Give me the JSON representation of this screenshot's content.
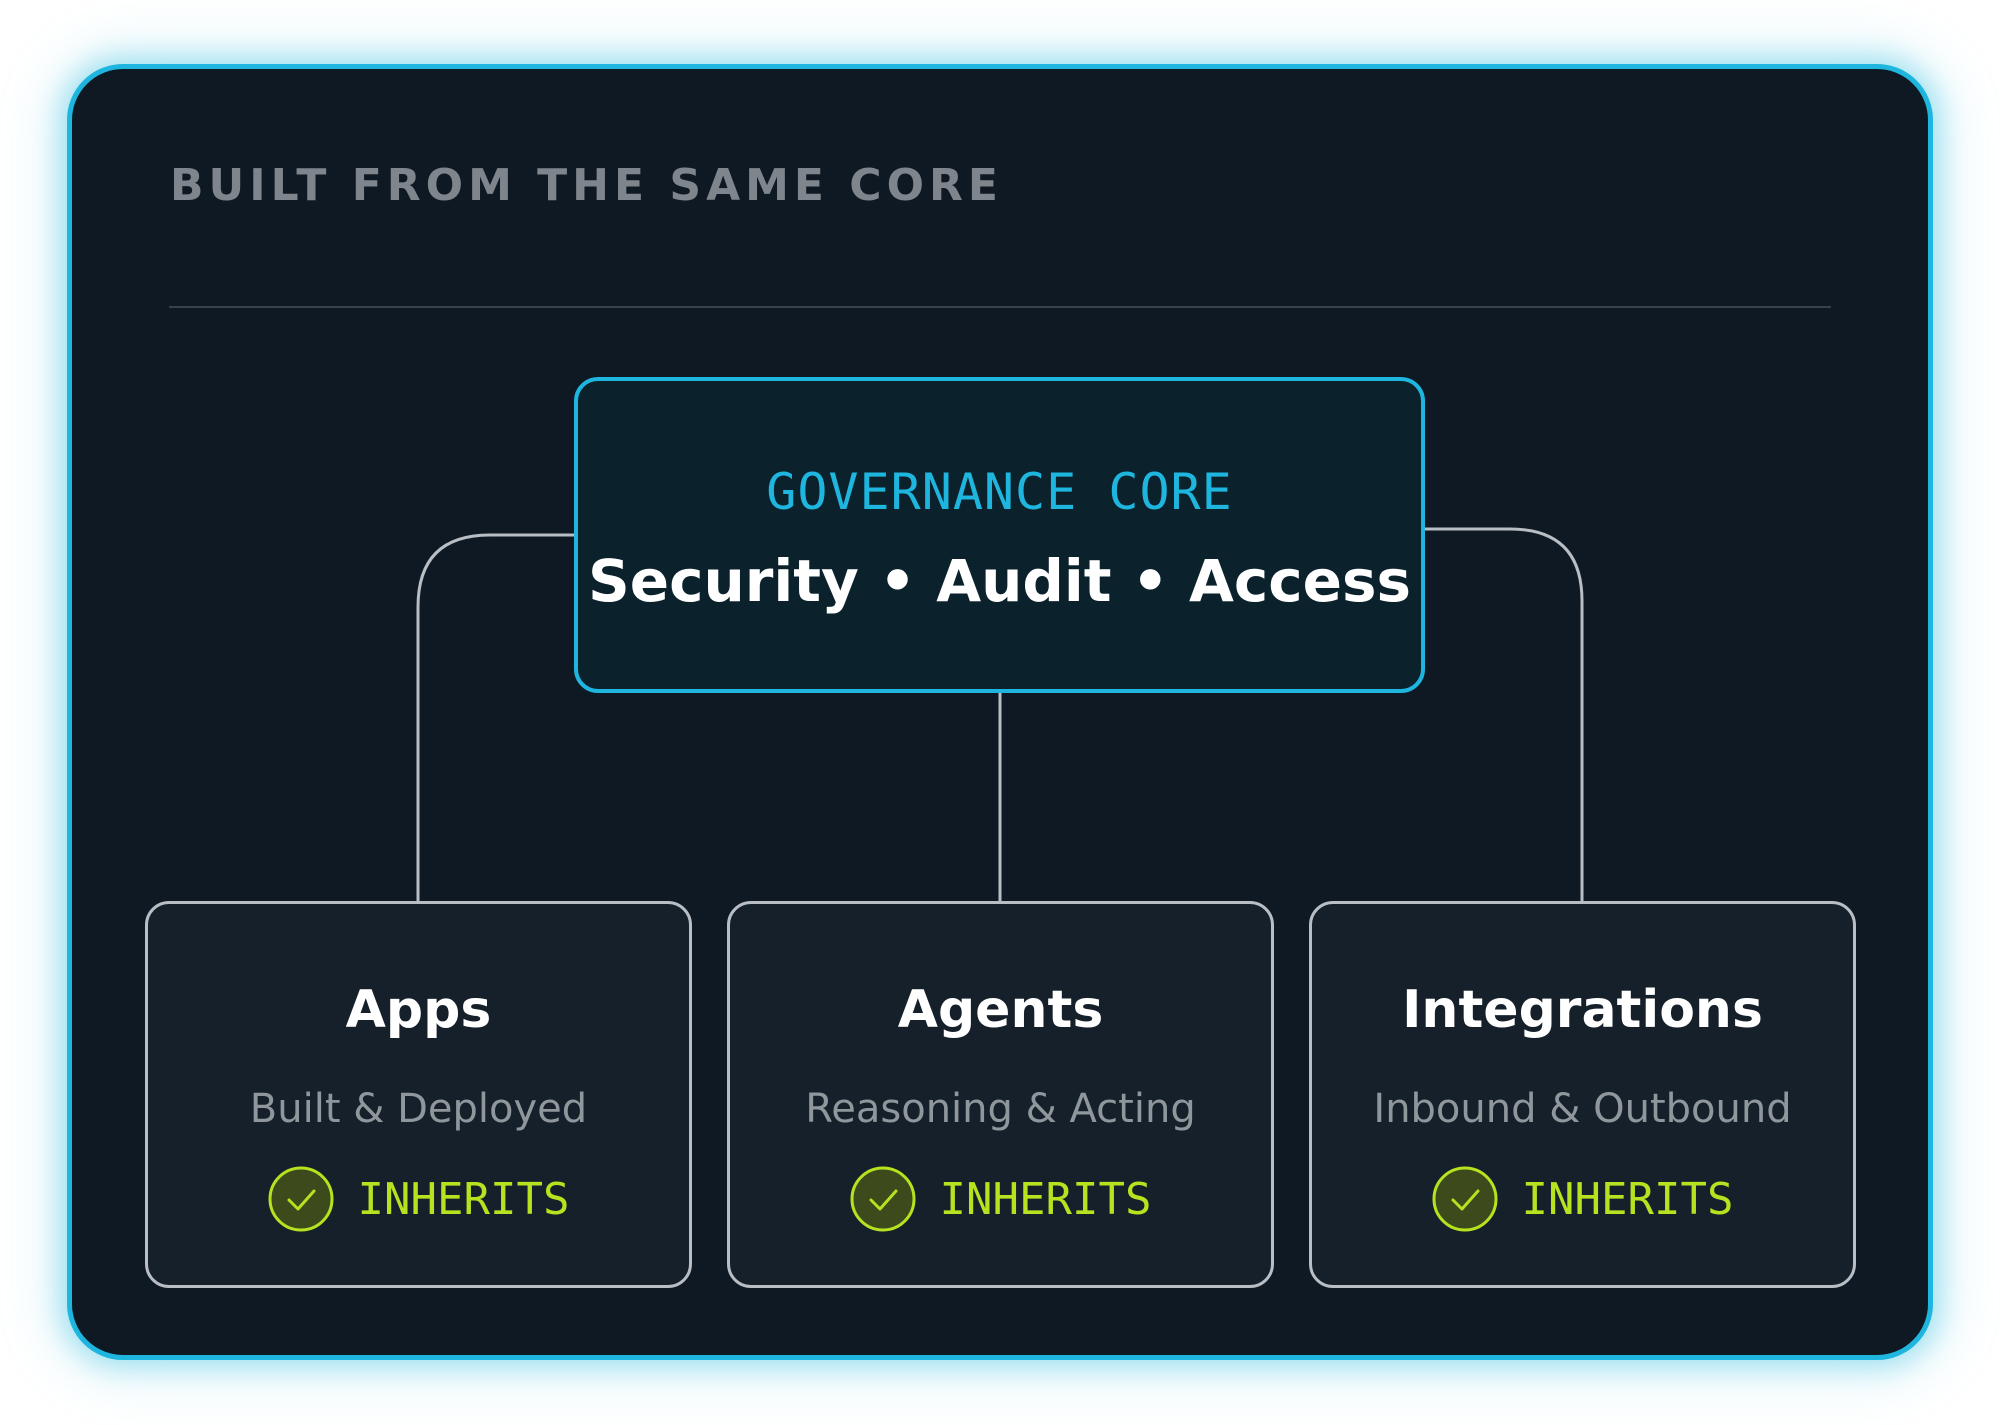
{
  "heading": "BUILT FROM THE SAME CORE",
  "core": {
    "label": "GOVERNANCE CORE",
    "title": "Security • Audit • Access"
  },
  "children": [
    {
      "title": "Apps",
      "subtitle": "Built & Deployed",
      "status": "INHERITS",
      "icon": "check-circle-icon"
    },
    {
      "title": "Agents",
      "subtitle": "Reasoning & Acting",
      "status": "INHERITS",
      "icon": "check-circle-icon"
    },
    {
      "title": "Integrations",
      "subtitle": "Inbound & Outbound",
      "status": "INHERITS",
      "icon": "check-circle-icon"
    }
  ],
  "colors": {
    "accent": "#1eb6de",
    "status": "#b6e21f",
    "background": "#0f1923"
  }
}
